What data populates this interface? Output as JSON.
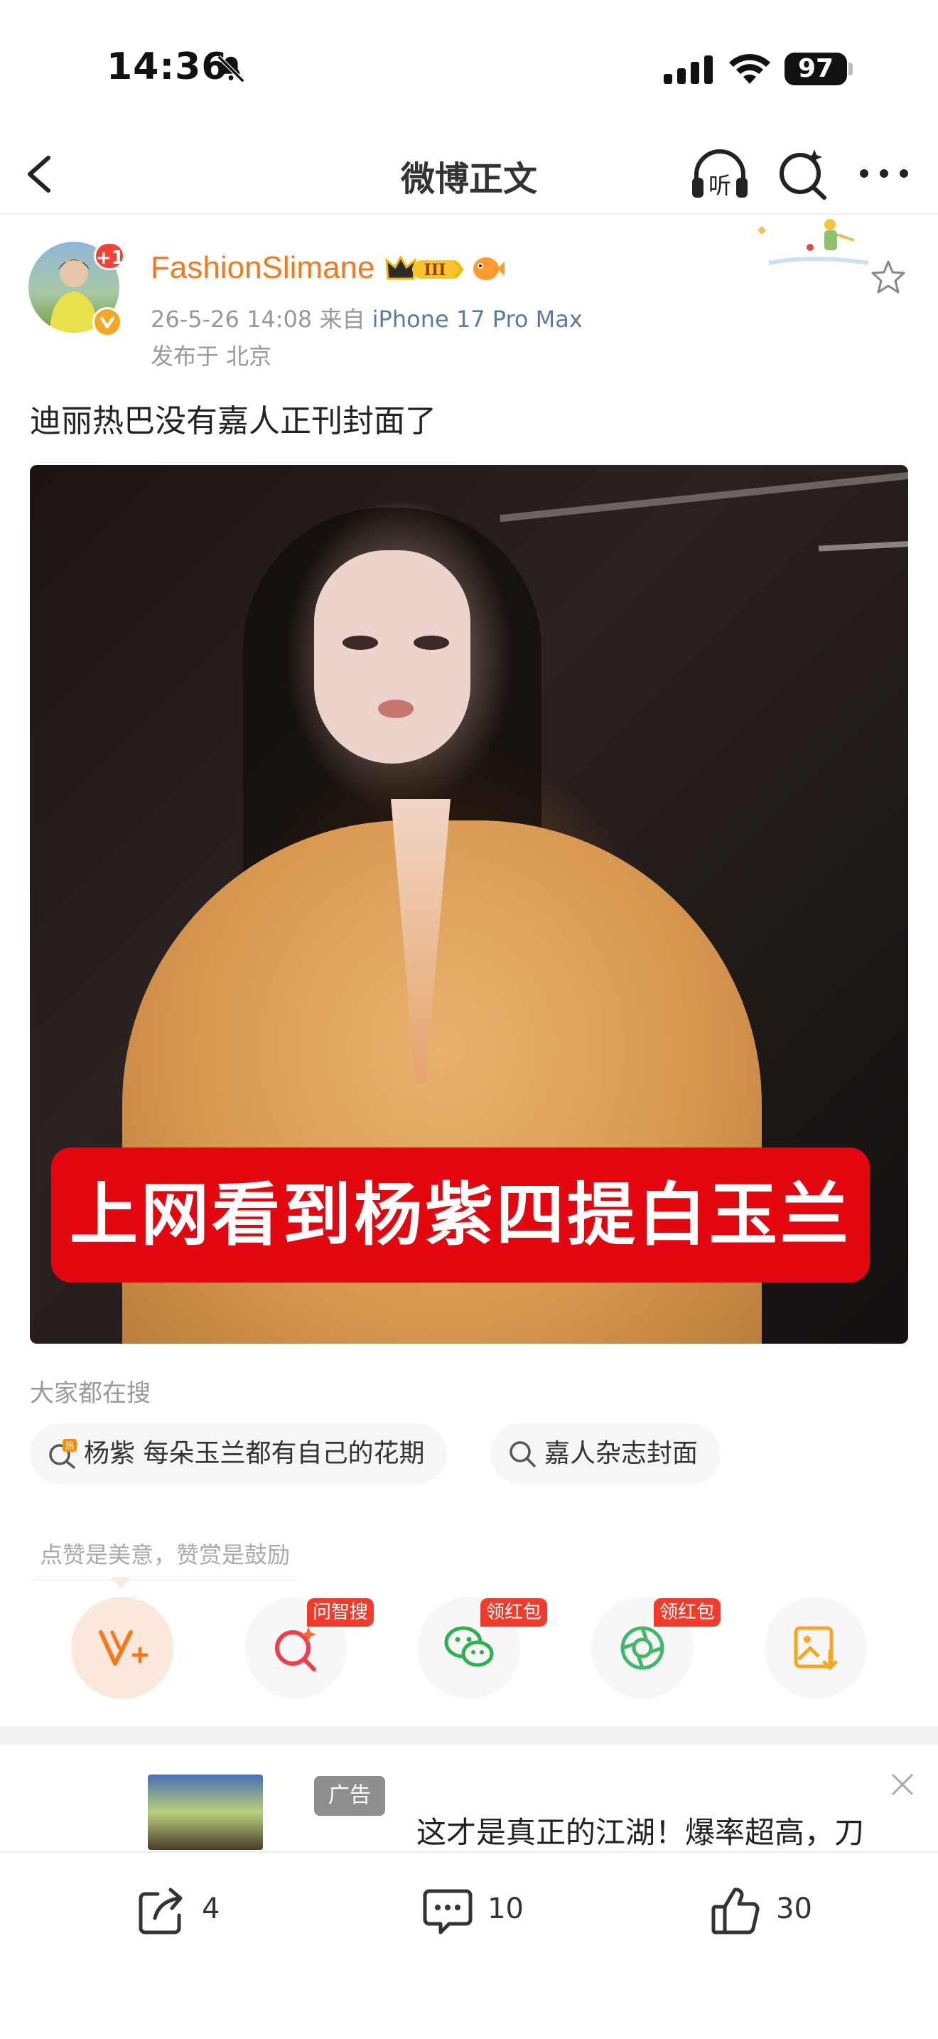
{
  "status_bar": {
    "time": "14:36",
    "battery": "97"
  },
  "nav": {
    "title": "微博正文"
  },
  "post": {
    "username": "FashionSlimane",
    "avatar_badge": "+1",
    "timestamp": "26-5-26 14:08",
    "source_prefix": "来自",
    "device": "iPhone 17 Pro Max",
    "location": "发布于 北京",
    "text": "迪丽热巴没有嘉人正刊封面了",
    "media_caption": "上网看到杨紫四提白玉兰"
  },
  "search": {
    "title": "大家都在搜",
    "chips": [
      {
        "label": "杨紫 每朵玉兰都有自己的花期",
        "icon": "hot-search-icon"
      },
      {
        "label": "嘉人杂志封面",
        "icon": "search-icon"
      }
    ]
  },
  "actions": {
    "hint": "点赞是美意，赞赏是鼓励",
    "tags": [
      "问智搜",
      "领红包",
      "领红包"
    ],
    "buttons": [
      "vplus-icon",
      "ai-search-icon",
      "wechat-icon",
      "moments-icon",
      "save-image-icon"
    ]
  },
  "ad": {
    "label": "广告",
    "text": "这才是真正的江湖！爆率超高，刀"
  },
  "toolbar": {
    "share_count": "4",
    "comment_count": "10",
    "like_count": "30"
  },
  "colors": {
    "username": "#f7781b",
    "caption_red": "#e3060e",
    "tag_red": "#f43a2a",
    "device_link": "#5b7ba5"
  }
}
